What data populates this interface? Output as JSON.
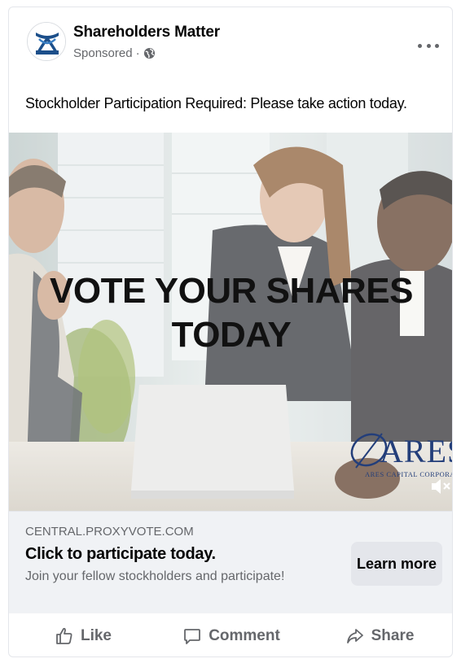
{
  "post": {
    "page_name": "Shareholders Matter",
    "sponsored_label": "Sponsored",
    "meta_separator": "·",
    "caption": "Stockholder Participation Required: Please take action today."
  },
  "media": {
    "overlay_line1": "VOTE YOUR SHARES",
    "overlay_line2": "TODAY",
    "logo_word": "ARES",
    "logo_subtitle": "ARES CAPITAL CORPORATION"
  },
  "link": {
    "domain": "CENTRAL.PROXYVOTE.COM",
    "headline": "Click to participate today.",
    "description": "Join your fellow stockholders and participate!",
    "cta_label": "Learn more"
  },
  "actions": {
    "like": "Like",
    "comment": "Comment",
    "share": "Share"
  },
  "icons": {
    "more": "more-options-icon",
    "globe": "globe-icon",
    "mute": "volume-muted-icon",
    "like": "thumbs-up-icon",
    "comment": "speech-bubble-icon",
    "share": "share-arrow-icon"
  },
  "colors": {
    "secondary_text": "#65676b",
    "link_bar_bg": "#f0f2f5",
    "button_bg": "#e4e6eb",
    "ares_blue": "#233e7a"
  }
}
